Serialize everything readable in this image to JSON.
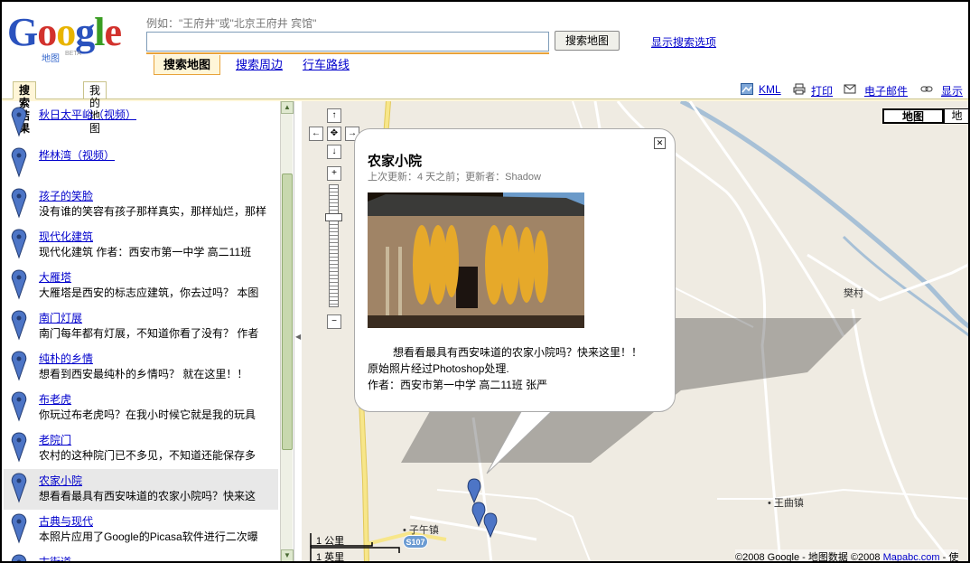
{
  "header": {
    "logo_text": "Google",
    "logo_sub": "地图",
    "logo_badge": "BETA",
    "example_text": "例如：\"王府井\"或\"北京王府井 宾馆\"",
    "search_value": "",
    "search_button": "搜索地图",
    "options_link": "显示搜索选项",
    "subtabs": [
      "搜索地图",
      "搜索周边",
      "行车路线"
    ]
  },
  "left_tabs": [
    "搜索结果",
    "我的地图"
  ],
  "toolbar": {
    "kml": "KML",
    "print": "打印",
    "email": "电子邮件",
    "link": "显示"
  },
  "results": [
    {
      "title": "秋日太平峪（视频）",
      "desc": ""
    },
    {
      "title": "桦林湾（视频）",
      "desc": ""
    },
    {
      "title": "孩子的笑脸",
      "desc": "没有谁的笑容有孩子那样真实，那样灿烂，那样"
    },
    {
      "title": "现代化建筑",
      "desc": "现代化建筑 作者：西安市第一中学 高二11班"
    },
    {
      "title": "大雁塔",
      "desc": "大雁塔是西安的标志应建筑，你去过吗？ 本图"
    },
    {
      "title": "南门灯展",
      "desc": "南门每年都有灯展，不知道你看了没有？ 作者"
    },
    {
      "title": "纯朴的乡情",
      "desc": "想看到西安最纯朴的乡情吗？ 就在这里！！"
    },
    {
      "title": "布老虎",
      "desc": "你玩过布老虎吗？在我小时候它就是我的玩具"
    },
    {
      "title": "老院门",
      "desc": "农村的这种院门已不多见，不知道还能保存多"
    },
    {
      "title": "农家小院",
      "desc": "想看看最具有西安味道的农家小院吗？快来这"
    },
    {
      "title": "古典与现代",
      "desc": "本照片应用了Google的Picasa软件进行二次曝"
    },
    {
      "title": "古街道",
      "desc": ""
    }
  ],
  "selected_index": 9,
  "map": {
    "types": [
      "地图",
      "地"
    ],
    "places": [
      "樊村",
      "王曲镇",
      "子午镇"
    ],
    "route_shield": "S107",
    "scale_km": "1 公里",
    "scale_mi": "1 英里",
    "copyright_prefix": "©2008 Google - 地图数据 ©2008 ",
    "copyright_link": "Mapabc.com",
    "copyright_suffix": " - 使"
  },
  "info_window": {
    "title": "农家小院",
    "meta": "上次更新：4 天之前；更新者：Shadow",
    "line1": "想看看最具有西安味道的农家小院吗？快来这里！！",
    "line2": "原始照片经过Photoshop处理.",
    "line3": "作者：西安市第一中学 高二11班 张严",
    "close_icon": "close-icon"
  },
  "colors": {
    "link": "#0000cc",
    "tab_accent": "#e8a33b",
    "map_bg": "#efebe2",
    "river": "#a7c0d6",
    "road_major": "#f7e68a",
    "pin": "#4d75c6"
  }
}
